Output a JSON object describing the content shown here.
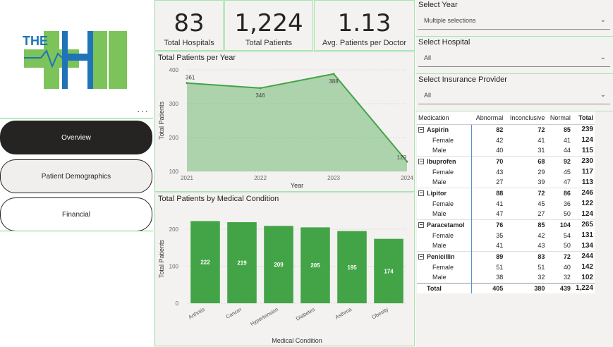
{
  "logo": {
    "text": "THE"
  },
  "nav": {
    "overview": "Overview",
    "demographics": "Patient Demographics",
    "financial": "Financial",
    "more": "···"
  },
  "kpis": [
    {
      "value": "83",
      "label": "Total Hospitals"
    },
    {
      "value": "1,224",
      "label": "Total Patients"
    },
    {
      "value": "1.13",
      "label": "Avg. Patients per Doctor"
    }
  ],
  "line_chart": {
    "title": "Total Patients per Year"
  },
  "bar_chart": {
    "title": "Total Patients by Medical Condition"
  },
  "chart_data": [
    {
      "type": "area",
      "title": "Total Patients per Year",
      "xlabel": "Year",
      "ylabel": "Total Patients",
      "x": [
        "2021",
        "2022",
        "2023",
        "2024"
      ],
      "values": [
        361,
        346,
        388,
        129
      ],
      "ylim": [
        100,
        400
      ],
      "yticks": [
        100,
        200,
        300,
        400
      ]
    },
    {
      "type": "bar",
      "title": "Total Patients by Medical Condition",
      "xlabel": "Medical Condition",
      "ylabel": "Total Patients",
      "categories": [
        "Arthritis",
        "Cancer",
        "Hypertension",
        "Diabetes",
        "Asthma",
        "Obesity"
      ],
      "values": [
        222,
        219,
        209,
        205,
        195,
        174
      ],
      "ylim": [
        0,
        240
      ],
      "yticks": [
        0,
        100,
        200
      ]
    }
  ],
  "slicers": [
    {
      "title": "Select Year",
      "value": "Multiple selections"
    },
    {
      "title": "Select Hospital",
      "value": "All"
    },
    {
      "title": "Select Insurance Provider",
      "value": "All"
    }
  ],
  "matrix": {
    "headers": [
      "Medication",
      "Abnormal",
      "Inconclusive",
      "Normal",
      "Total"
    ],
    "groups": [
      {
        "name": "Aspirin",
        "values": [
          "82",
          "72",
          "85",
          "239"
        ],
        "rows": [
          {
            "name": "Female",
            "values": [
              "42",
              "41",
              "41",
              "124"
            ]
          },
          {
            "name": "Male",
            "values": [
              "40",
              "31",
              "44",
              "115"
            ]
          }
        ]
      },
      {
        "name": "Ibuprofen",
        "values": [
          "70",
          "68",
          "92",
          "230"
        ],
        "rows": [
          {
            "name": "Female",
            "values": [
              "43",
              "29",
              "45",
              "117"
            ]
          },
          {
            "name": "Male",
            "values": [
              "27",
              "39",
              "47",
              "113"
            ]
          }
        ]
      },
      {
        "name": "Lipitor",
        "values": [
          "88",
          "72",
          "86",
          "246"
        ],
        "rows": [
          {
            "name": "Female",
            "values": [
              "41",
              "45",
              "36",
              "122"
            ]
          },
          {
            "name": "Male",
            "values": [
              "47",
              "27",
              "50",
              "124"
            ]
          }
        ]
      },
      {
        "name": "Paracetamol",
        "values": [
          "76",
          "85",
          "104",
          "265"
        ],
        "rows": [
          {
            "name": "Female",
            "values": [
              "35",
              "42",
              "54",
              "131"
            ]
          },
          {
            "name": "Male",
            "values": [
              "41",
              "43",
              "50",
              "134"
            ]
          }
        ]
      },
      {
        "name": "Penicillin",
        "values": [
          "89",
          "83",
          "72",
          "244"
        ],
        "rows": [
          {
            "name": "Female",
            "values": [
              "51",
              "51",
              "40",
              "142"
            ]
          },
          {
            "name": "Male",
            "values": [
              "38",
              "32",
              "32",
              "102"
            ]
          }
        ]
      }
    ],
    "total": {
      "name": "Total",
      "values": [
        "405",
        "380",
        "439",
        "1,224"
      ]
    }
  },
  "colors": {
    "accent": "#43a447",
    "border": "#a6e3ae",
    "logo_blue": "#1f73b7",
    "logo_green": "#7cc35a"
  }
}
